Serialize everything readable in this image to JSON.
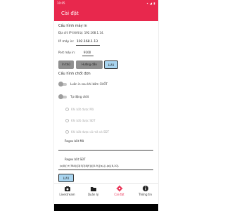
{
  "status_bar": {
    "time": "10:05"
  },
  "app_bar": {
    "title": "Cài đặt"
  },
  "printer_config": {
    "title": "Cấu hình máy in",
    "device_ip_text": "Địa chỉ IP thiết bị: 192.168.1.14.",
    "printer_ip_label": "IP máy in:",
    "printer_ip_value": "192.168.1.13",
    "port_label": "Port máy in:",
    "port_value": "9100",
    "buttons": {
      "test_print": "In thử",
      "guide": "Hướng dẫn",
      "save": "LƯU"
    }
  },
  "capture_config": {
    "title": "Cấu hình chốt đơn",
    "toggle_always_print": {
      "label": "Luôn in sau khi bấm CHỐT",
      "on": false
    },
    "toggle_auto_capture": {
      "label": "Tự động chốt",
      "on": false
    },
    "radio_options": [
      "Khi bắt được Mã",
      "Khi bắt được SĐT",
      "Khi bắt được cả mã và SĐT"
    ],
    "regex_code_label": "Regex bắt Mã",
    "regex_code_value": "",
    "regex_phone_label": "Regex bắt SĐT",
    "regex_phone_value": "(o|0|(\\+)?84)([3|5|7|8|9])([0-9]{\\s|-|\\.|o){8,10}",
    "save_button": "LƯU"
  },
  "bottom_nav": {
    "items": [
      {
        "label": "Livestream",
        "icon": "camera-icon"
      },
      {
        "label": "Quản lý",
        "icon": "folder-icon"
      },
      {
        "label": "Cài đặt",
        "icon": "gear-icon",
        "active": true
      },
      {
        "label": "Thông tin",
        "icon": "info-icon"
      }
    ]
  },
  "colors": {
    "primary": "#e8284d",
    "button_gray": "#8f8f8f",
    "button_blue": "#a9d5f0"
  }
}
